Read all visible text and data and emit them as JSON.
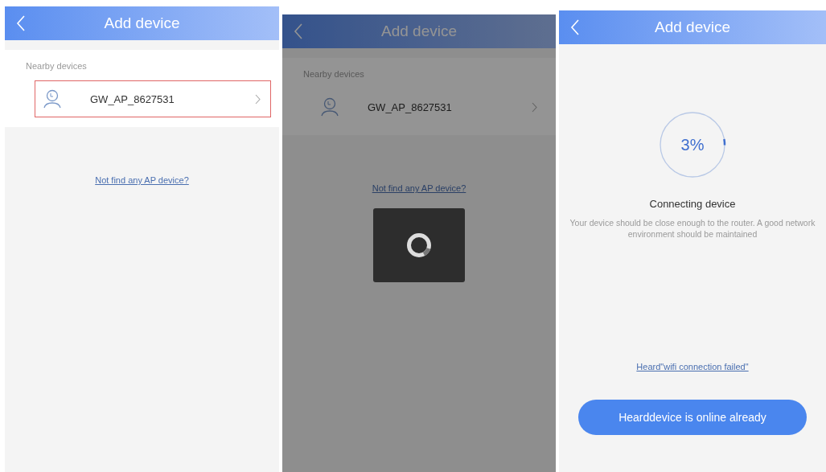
{
  "screens": [
    {
      "kind": "device_list",
      "header": {
        "title": "Add device"
      },
      "section_label": "Nearby devices",
      "devices": [
        {
          "name": "GW_AP_8627531",
          "selected": true
        }
      ],
      "help_link": "Not find any AP device?"
    },
    {
      "kind": "device_list",
      "header": {
        "title": "Add device"
      },
      "section_label": "Nearby devices",
      "devices": [
        {
          "name": "GW_AP_8627531",
          "selected": false
        }
      ],
      "help_link": "Not find any AP device?",
      "dimmed": true,
      "loading": true
    },
    {
      "kind": "connecting",
      "header": {
        "title": "Add device"
      },
      "progress": {
        "level": 0.03,
        "reading": "3%"
      },
      "status": "Connecting device",
      "hint": "Your device should be close enough to the router. A good network environment should be maintained",
      "help_link": "Heard\"wifi connection failed\"",
      "button": "Hearddevice is online already"
    }
  ]
}
